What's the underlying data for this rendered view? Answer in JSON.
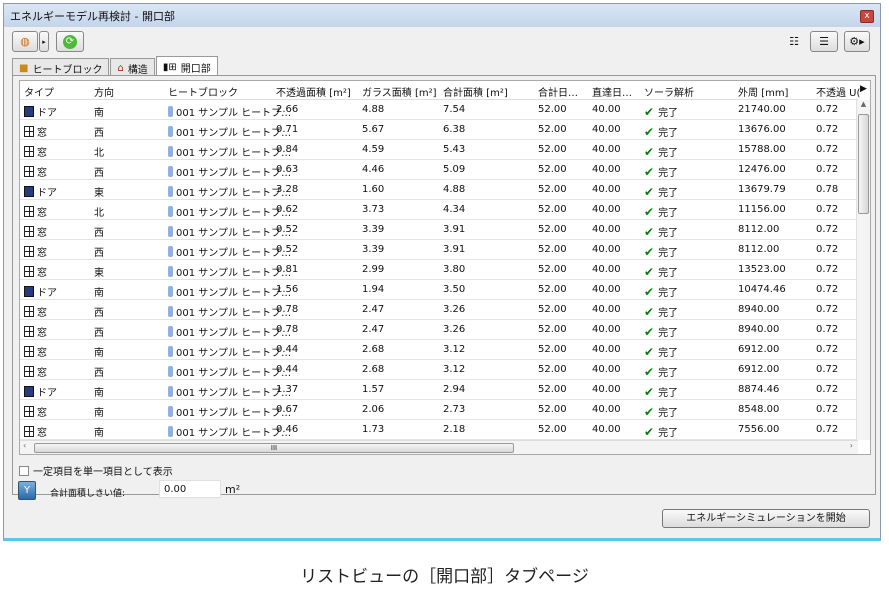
{
  "window": {
    "title": "エネルギーモデル再検討 - 開口部",
    "close": "x"
  },
  "tabs": [
    {
      "label": "ヒートブロック"
    },
    {
      "label": "構造"
    },
    {
      "label": "開口部"
    }
  ],
  "columns": [
    "タイプ",
    "方向",
    "ヒートブロック",
    "不透過面積 [m²]",
    "ガラス面積 [m²]",
    "合計面積 [m²]",
    "",
    "合計日…",
    "直達日…",
    "ソーラ解析",
    "外周 [mm]",
    "不透過 U("
  ],
  "rows": [
    [
      "ドア",
      "南",
      "001 サンプル ヒートブ…",
      "2.66",
      "4.88",
      "7.54",
      "",
      "52.00",
      "40.00",
      "完了",
      "21740.00",
      "0.72"
    ],
    [
      "窓",
      "西",
      "001 サンプル ヒートブ…",
      "0.71",
      "5.67",
      "6.38",
      "",
      "52.00",
      "40.00",
      "完了",
      "13676.00",
      "0.72"
    ],
    [
      "窓",
      "北",
      "001 サンプル ヒートブ…",
      "0.84",
      "4.59",
      "5.43",
      "",
      "52.00",
      "40.00",
      "完了",
      "15788.00",
      "0.72"
    ],
    [
      "窓",
      "西",
      "001 サンプル ヒートブ…",
      "0.63",
      "4.46",
      "5.09",
      "",
      "52.00",
      "40.00",
      "完了",
      "12476.00",
      "0.72"
    ],
    [
      "ドア",
      "東",
      "001 サンプル ヒートブ…",
      "3.28",
      "1.60",
      "4.88",
      "",
      "52.00",
      "40.00",
      "完了",
      "13679.79",
      "0.78"
    ],
    [
      "窓",
      "北",
      "001 サンプル ヒートブ…",
      "0.62",
      "3.73",
      "4.34",
      "",
      "52.00",
      "40.00",
      "完了",
      "11156.00",
      "0.72"
    ],
    [
      "窓",
      "西",
      "001 サンプル ヒートブ…",
      "0.52",
      "3.39",
      "3.91",
      "",
      "52.00",
      "40.00",
      "完了",
      "8112.00",
      "0.72"
    ],
    [
      "窓",
      "西",
      "001 サンプル ヒートブ…",
      "0.52",
      "3.39",
      "3.91",
      "",
      "52.00",
      "40.00",
      "完了",
      "8112.00",
      "0.72"
    ],
    [
      "窓",
      "東",
      "001 サンプル ヒートブ…",
      "0.81",
      "2.99",
      "3.80",
      "",
      "52.00",
      "40.00",
      "完了",
      "13523.00",
      "0.72"
    ],
    [
      "ドア",
      "南",
      "001 サンプル ヒートブ…",
      "1.56",
      "1.94",
      "3.50",
      "",
      "52.00",
      "40.00",
      "完了",
      "10474.46",
      "0.72"
    ],
    [
      "窓",
      "西",
      "001 サンプル ヒートブ…",
      "0.78",
      "2.47",
      "3.26",
      "",
      "52.00",
      "40.00",
      "完了",
      "8940.00",
      "0.72"
    ],
    [
      "窓",
      "西",
      "001 サンプル ヒートブ…",
      "0.78",
      "2.47",
      "3.26",
      "",
      "52.00",
      "40.00",
      "完了",
      "8940.00",
      "0.72"
    ],
    [
      "窓",
      "南",
      "001 サンプル ヒートブ…",
      "0.44",
      "2.68",
      "3.12",
      "",
      "52.00",
      "40.00",
      "完了",
      "6912.00",
      "0.72"
    ],
    [
      "窓",
      "西",
      "001 サンプル ヒートブ…",
      "0.44",
      "2.68",
      "3.12",
      "",
      "52.00",
      "40.00",
      "完了",
      "6912.00",
      "0.72"
    ],
    [
      "ドア",
      "南",
      "001 サンプル ヒートブ…",
      "1.37",
      "1.57",
      "2.94",
      "",
      "52.00",
      "40.00",
      "完了",
      "8874.46",
      "0.72"
    ],
    [
      "窓",
      "南",
      "001 サンプル ヒートブ…",
      "0.67",
      "2.06",
      "2.73",
      "",
      "52.00",
      "40.00",
      "完了",
      "8548.00",
      "0.72"
    ],
    [
      "窓",
      "南",
      "001 サンプル ヒートブ…",
      "0.46",
      "1.73",
      "2.18",
      "",
      "52.00",
      "40.00",
      "完了",
      "7556.00",
      "0.72"
    ]
  ],
  "options": {
    "single_item_label": "一定項目を単一項目として表示",
    "threshold_label": "合計面積しきい値:",
    "threshold_value": "0.00",
    "threshold_unit": "m²"
  },
  "start_button": "エネルギーシミュレーションを開始",
  "caption": "リストビューの［開口部］タブページ"
}
